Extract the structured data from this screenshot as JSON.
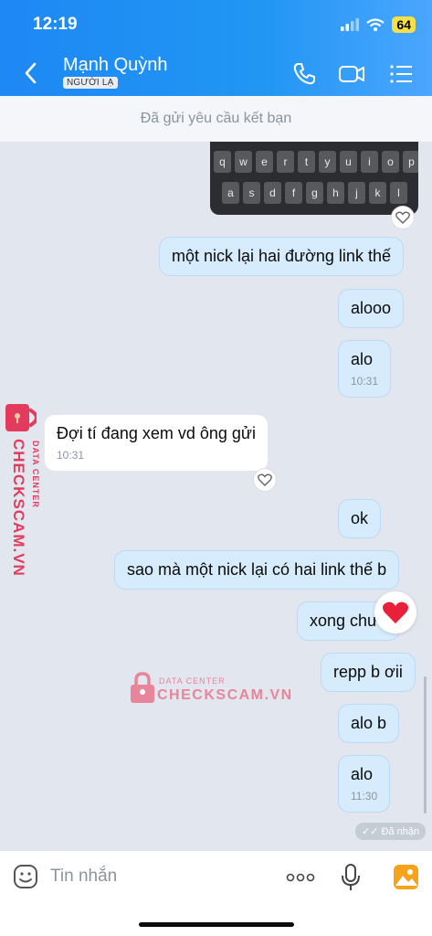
{
  "status_bar": {
    "time": "12:19",
    "battery": "64"
  },
  "header": {
    "contact_name": "Mạnh Quỳnh",
    "badge": "NGƯỜI LẠ"
  },
  "friend_request_banner": "Đã gửi yêu cầu kết bạn",
  "keyboard_rows": [
    [
      "q",
      "w",
      "e",
      "r",
      "t",
      "y",
      "u",
      "i",
      "o",
      "p"
    ],
    [
      "a",
      "s",
      "d",
      "f",
      "g",
      "h",
      "j",
      "k",
      "l"
    ]
  ],
  "messages": [
    {
      "dir": "out",
      "text": "một nick lại hai đường link thế",
      "time": ""
    },
    {
      "dir": "out",
      "text": "alooo",
      "time": ""
    },
    {
      "dir": "out",
      "text": "alo",
      "time": "10:31"
    },
    {
      "dir": "in",
      "text": "Đợi tí đang xem vd ông gửi",
      "time": "10:31"
    },
    {
      "dir": "out",
      "text": "ok",
      "time": ""
    },
    {
      "dir": "out",
      "text": "sao mà một nick lại có hai link thế b",
      "time": ""
    },
    {
      "dir": "out",
      "text": "xong chưa",
      "time": ""
    },
    {
      "dir": "out",
      "text": "repp b ơii",
      "time": ""
    },
    {
      "dir": "out",
      "text": "alo b",
      "time": ""
    },
    {
      "dir": "out",
      "text": "alo",
      "time": "11:30"
    }
  ],
  "seen_status": "Đã nhận",
  "composer": {
    "placeholder": "Tin nhắn"
  },
  "watermark": {
    "small": "DATA CENTER",
    "big": "CHECKSCAM.VN"
  },
  "colors": {
    "header": "#2196f3",
    "bubble_out": "#d6ebfc",
    "bubble_in": "#ffffff",
    "heart": "#e8203a",
    "watermark": "#e23b5e"
  }
}
